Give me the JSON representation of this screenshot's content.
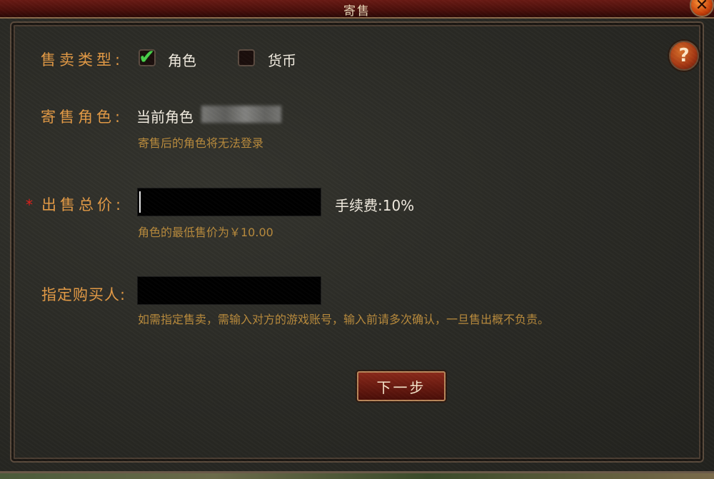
{
  "window": {
    "title": "寄售"
  },
  "form": {
    "sale_type": {
      "label": "售卖类型:",
      "options": [
        {
          "label": "角色",
          "checked": true
        },
        {
          "label": "货币",
          "checked": false
        }
      ]
    },
    "consign_role": {
      "label": "寄售角色:",
      "value": "当前角色",
      "hint": "寄售后的角色将无法登录"
    },
    "total_price": {
      "required_mark": "*",
      "label": "出售总价:",
      "value": "",
      "fee": "手续费:10%",
      "hint": "角色的最低售价为￥10.00"
    },
    "buyer": {
      "label": "指定购买人:",
      "value": "",
      "hint": "如需指定售卖，需输入对方的游戏账号，输入前请多次确认，一旦售出概不负责。"
    }
  },
  "buttons": {
    "next": "下一步",
    "help": "?",
    "close": "✕"
  },
  "colors": {
    "label": "#e39a45",
    "hint": "#b88a3c",
    "title_bar": "#5a140e",
    "check": "#4ad04a"
  }
}
